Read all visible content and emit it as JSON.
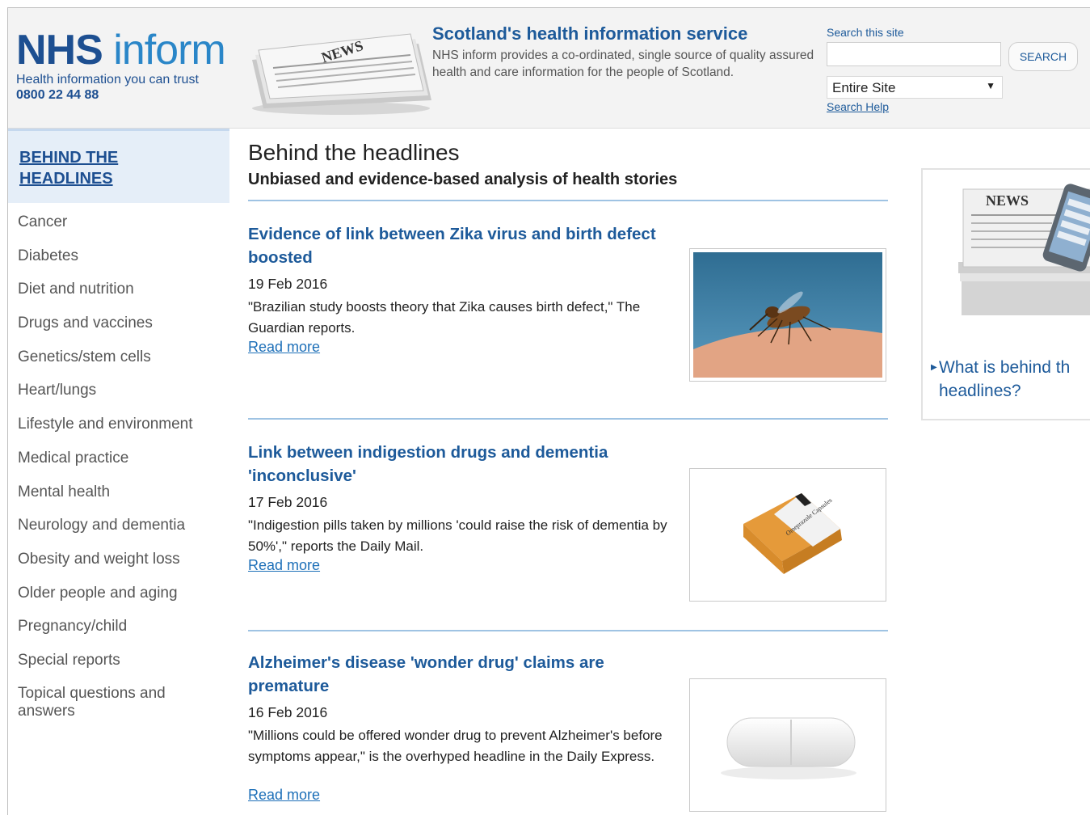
{
  "header": {
    "logo_nhs": "NHS",
    "logo_inform": "inform",
    "tagline": "Health information you can trust",
    "phone": "0800 22 44 88",
    "news_graphic_text": "NEWS",
    "intro_title": "Scotland's health information service",
    "intro_text": "NHS inform provides a co-ordinated, single source of quality assured health and care information for the people of Scotland.",
    "search_label": "Search this site",
    "search_value": "",
    "search_button": "SEARCH",
    "scope_selected": "Entire Site",
    "search_help": "Search Help"
  },
  "sidebar": {
    "heading": "BEHIND THE HEADLINES",
    "items": [
      {
        "label": "Cancer"
      },
      {
        "label": "Diabetes"
      },
      {
        "label": "Diet and nutrition"
      },
      {
        "label": "Drugs and vaccines"
      },
      {
        "label": "Genetics/stem cells"
      },
      {
        "label": "Heart/lungs"
      },
      {
        "label": "Lifestyle and environment"
      },
      {
        "label": "Medical practice"
      },
      {
        "label": "Mental health"
      },
      {
        "label": "Neurology and dementia"
      },
      {
        "label": "Obesity and weight loss"
      },
      {
        "label": "Older people and aging"
      },
      {
        "label": "Pregnancy/child"
      },
      {
        "label": "Special reports"
      },
      {
        "label": "Topical questions and answers"
      }
    ]
  },
  "main": {
    "title": "Behind the headlines",
    "subtitle": "Unbiased and evidence-based analysis of health stories",
    "articles": [
      {
        "title": "Evidence of link between Zika virus and birth defect boosted",
        "date": "19 Feb 2016",
        "text": "\"Brazilian study boosts theory that Zika causes birth defect,\" The Guardian reports.",
        "more": "Read more",
        "image": "mosquito-image"
      },
      {
        "title": "Link between indigestion drugs and dementia 'inconclusive'",
        "date": "17 Feb 2016",
        "text": "\"Indigestion pills taken by millions 'could raise the risk of dementia by 50%',\" reports the Daily Mail.",
        "more": "Read more",
        "image": "pill-box-image",
        "box_label": "Omeprazole Capsules"
      },
      {
        "title": "Alzheimer's disease 'wonder drug' claims are premature",
        "date": "16 Feb 2016",
        "text": "\"Millions could be offered wonder drug to prevent Alzheimer's before symptoms appear,\" is the overhyped headline in the Daily Express.",
        "more": "Read more",
        "image": "white-pill-image"
      }
    ]
  },
  "promo": {
    "news_text": "NEWS",
    "link": "What is behind the headlines?"
  },
  "colors": {
    "brand_blue": "#1d4f91",
    "link_blue": "#1d5a9a",
    "light_blue": "#2a86c8",
    "rule_blue": "#9fc3e3"
  }
}
